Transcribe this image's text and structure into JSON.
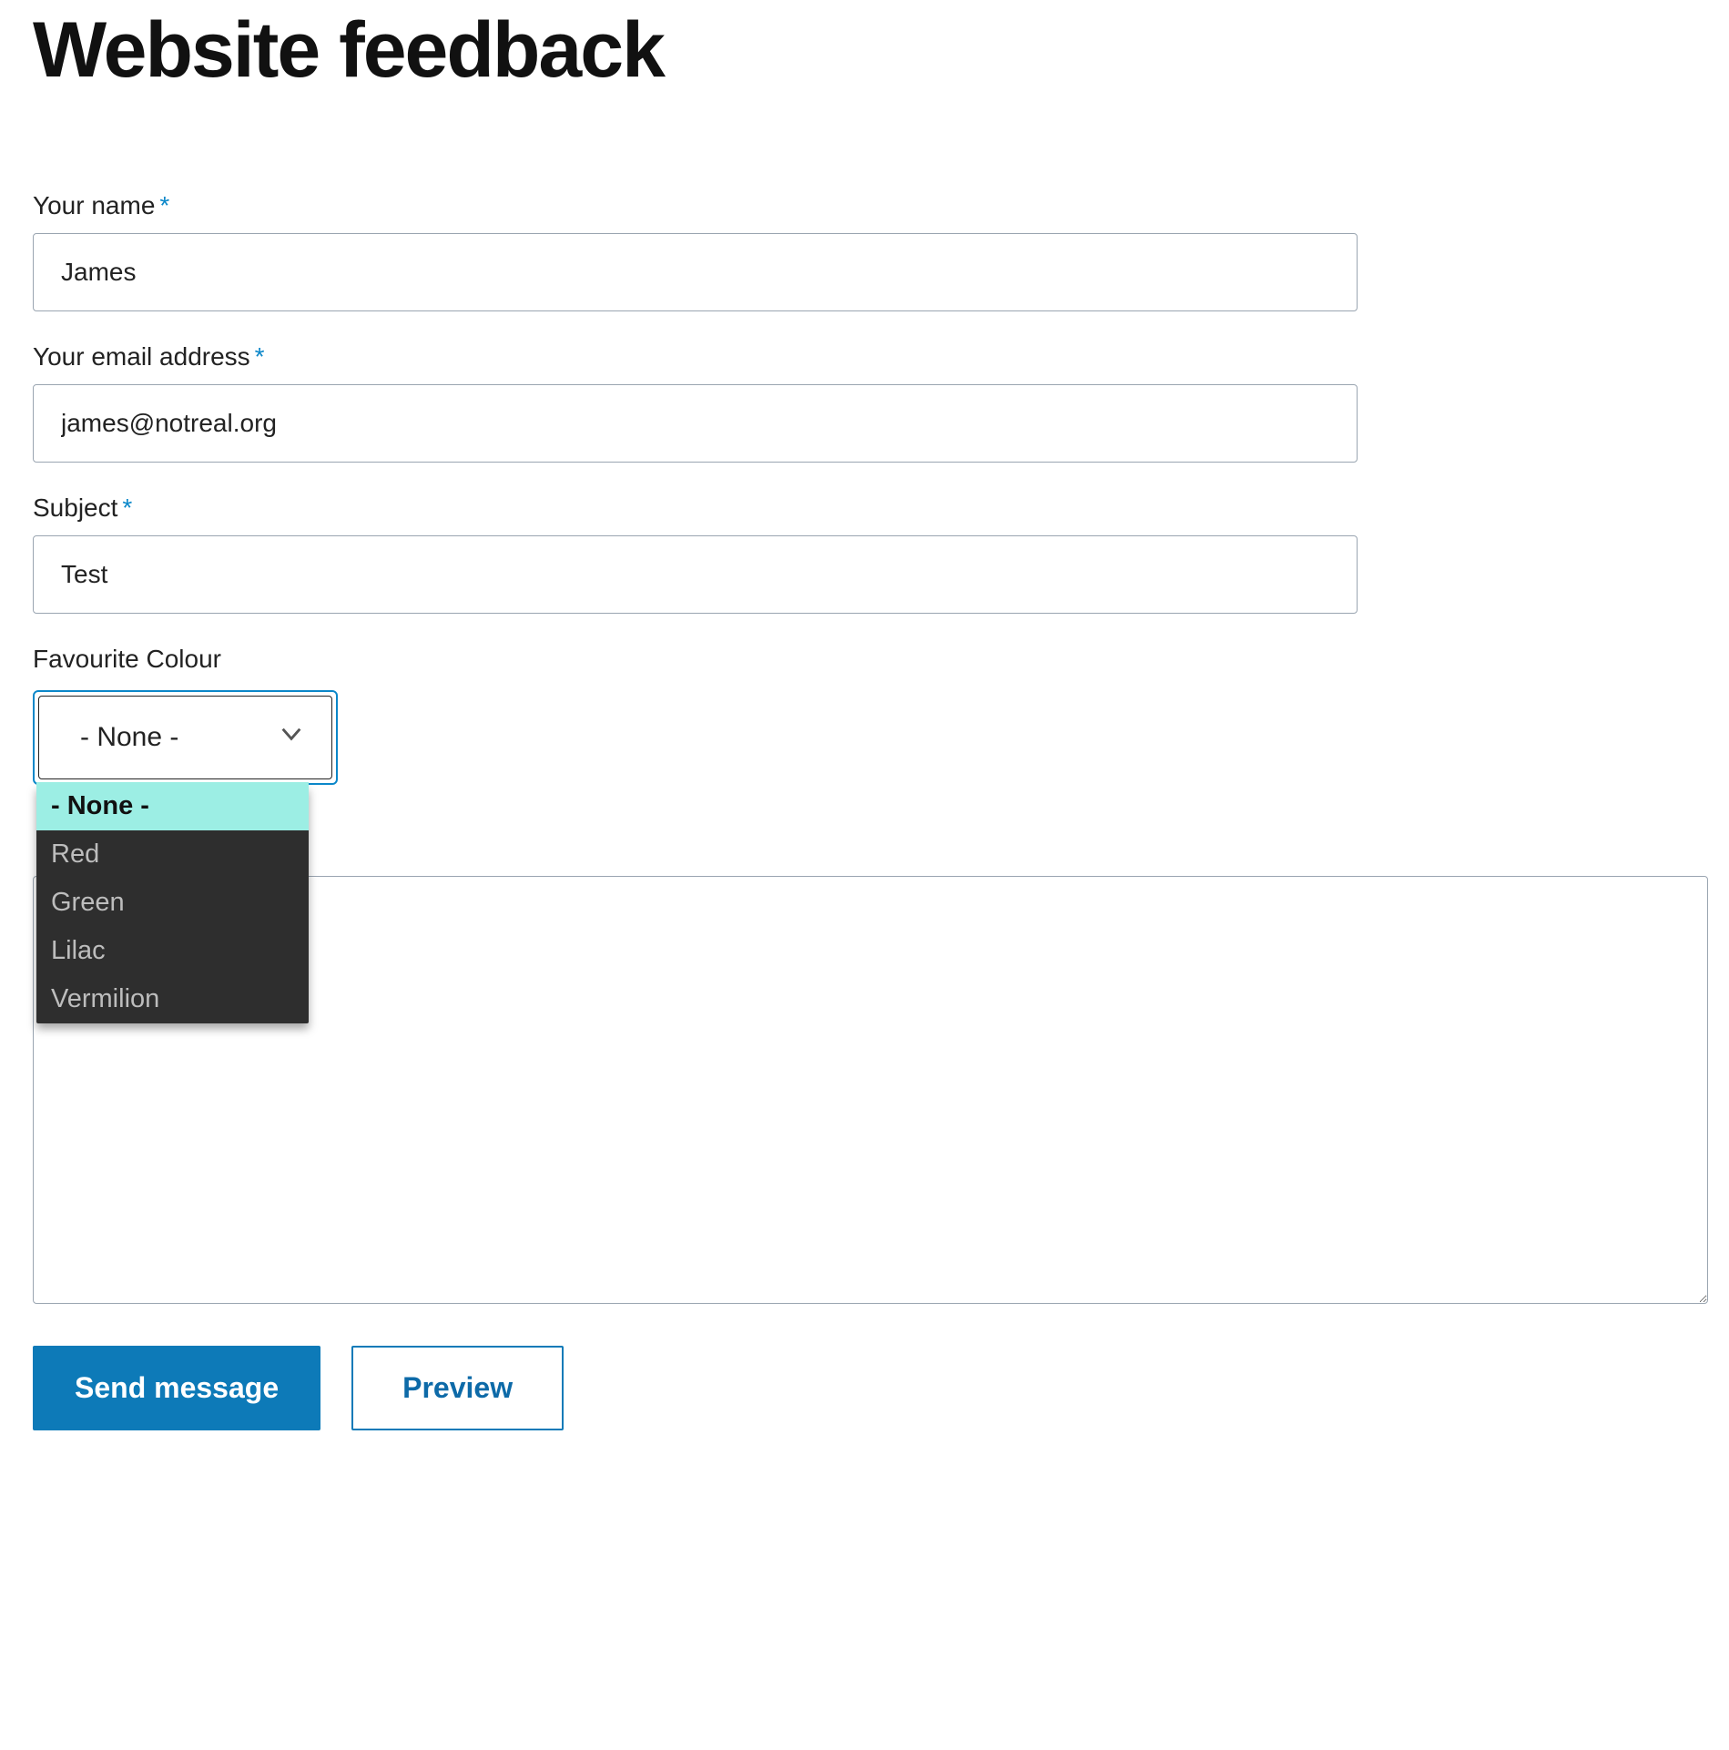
{
  "page": {
    "title": "Website feedback"
  },
  "form": {
    "name": {
      "label": "Your name",
      "required": "*",
      "value": "James"
    },
    "email": {
      "label": "Your email address",
      "required": "*",
      "value": "james@notreal.org"
    },
    "subject": {
      "label": "Subject",
      "required": "*",
      "value": "Test"
    },
    "colour": {
      "label": "Favourite Colour",
      "selected": "- None -",
      "options": [
        "- None -",
        "Red",
        "Green",
        "Lilac",
        "Vermilion"
      ]
    },
    "message": {
      "value": ""
    },
    "buttons": {
      "submit": "Send message",
      "preview": "Preview"
    }
  }
}
